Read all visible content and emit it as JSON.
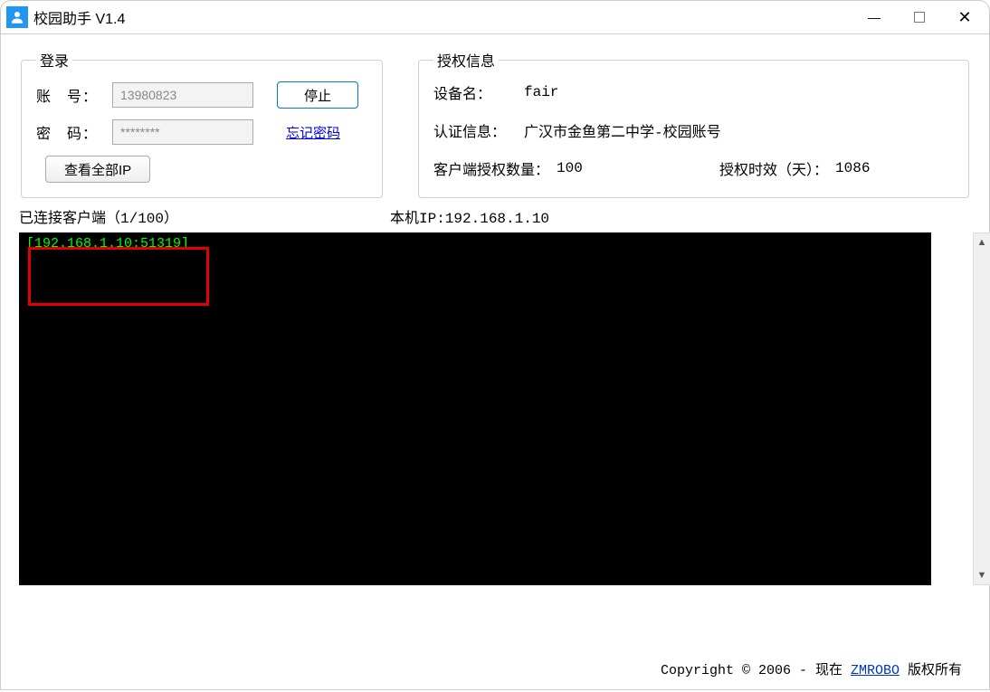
{
  "window": {
    "title": "校园助手 V1.4"
  },
  "login": {
    "legend": "登录",
    "account_label": "账　号：",
    "account_value": "13980823",
    "password_label": "密　码：",
    "password_value": "********",
    "stop_btn": "停止",
    "forget_link": "忘记密码",
    "all_ip_btn": "查看全部IP"
  },
  "auth": {
    "legend": "授权信息",
    "device_label": "设备名：",
    "device_value": "fair",
    "cert_label": "认证信息：",
    "cert_value": "广汉市金鱼第二中学-校园账号",
    "count_label": "客户端授权数量：",
    "count_value": "100",
    "expire_label": "授权时效（天）：",
    "expire_value": "1086"
  },
  "status": {
    "connected_label": "已连接客户端（1/100）",
    "local_ip_label": "本机IP:192.168.1.10"
  },
  "console": {
    "line1": "[192.168.1.10:51319]"
  },
  "footer": {
    "prefix": "Copyright © 2006 - 现在 ",
    "link": "ZMROBO",
    "suffix": " 版权所有"
  }
}
